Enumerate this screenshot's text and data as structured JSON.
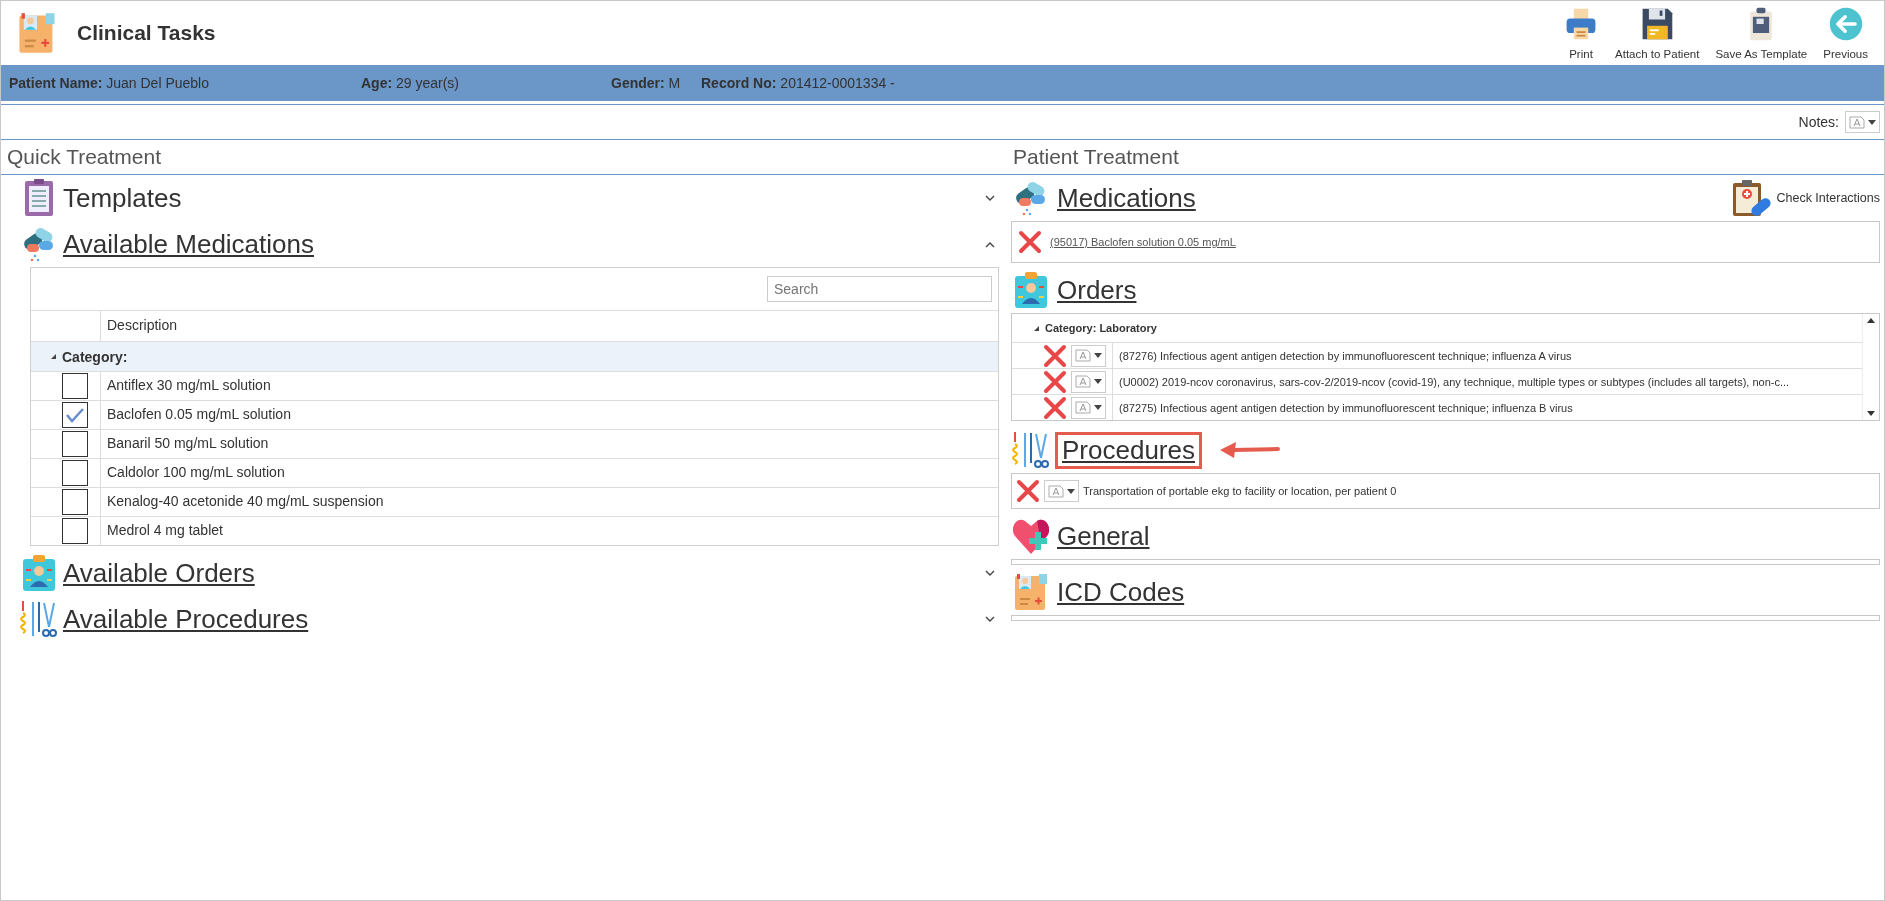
{
  "window": {
    "title": "Clinical Tasks"
  },
  "toolbar": [
    {
      "kind": "print",
      "label": "Print"
    },
    {
      "kind": "attach",
      "label": "Attach to Patient"
    },
    {
      "kind": "template",
      "label": "Save As Template"
    },
    {
      "kind": "previous",
      "label": "Previous"
    }
  ],
  "patient_bar": [
    {
      "label": "Patient Name:",
      "value": "Juan Del Pueblo"
    },
    {
      "label": "Age:",
      "value": "29 year(s)"
    },
    {
      "label": "Gender:",
      "value": "M"
    },
    {
      "label": "Record No:",
      "value": "201412-0001334 -"
    }
  ],
  "notes": {
    "label": "Notes:"
  },
  "quick_treatment": {
    "title": "Quick Treatment",
    "sections": [
      {
        "kind": "templates",
        "title": "Templates",
        "underlined": false,
        "expanded": false
      },
      {
        "kind": "medications",
        "title": "Available Medications",
        "underlined": true,
        "expanded": true,
        "table": {
          "search": {
            "placeholder": "Search"
          },
          "columns": [
            "Description"
          ],
          "group": "Category:",
          "rows": [
            {
              "text": "Antiflex 30 mg/mL solution",
              "checked": false
            },
            {
              "text": "Baclofen 0.05 mg/mL solution",
              "checked": true
            },
            {
              "text": "Banaril 50 mg/mL solution",
              "checked": false
            },
            {
              "text": "Caldolor 100 mg/mL solution",
              "checked": false
            },
            {
              "text": "Kenalog-40 acetonide 40 mg/mL suspension",
              "checked": false
            },
            {
              "text": "Medrol 4 mg tablet",
              "checked": false
            }
          ]
        }
      },
      {
        "kind": "orders",
        "title": "Available Orders",
        "underlined": true,
        "expanded": false
      },
      {
        "kind": "procedures",
        "title": "Available Procedures",
        "underlined": true,
        "expanded": false
      }
    ]
  },
  "patient_treatment": {
    "title": "Patient Treatment",
    "sections": [
      {
        "kind": "medications",
        "title": "Medications",
        "action": "Check Interactions",
        "items": [
          {
            "text": "(95017) Baclofen solution 0.05 mg/mL"
          }
        ]
      },
      {
        "kind": "orders",
        "title": "Orders",
        "group": "Category: Laboratory",
        "items": [
          {
            "text": "(87276) Infectious agent antigen detection by immunofluorescent technique; influenza A virus"
          },
          {
            "text": "(U0002) 2019-ncov coronavirus, sars-cov-2/2019-ncov (covid-19), any technique, multiple types or subtypes (includes all targets), non-c..."
          },
          {
            "text": "(87275) Infectious agent antigen detection by immunofluorescent technique; influenza B virus"
          }
        ]
      },
      {
        "kind": "procedures",
        "title": "Procedures",
        "highlighted": true,
        "items": [
          {
            "text": "Transportation of portable ekg to facility or location, per patient 0"
          }
        ]
      },
      {
        "kind": "general",
        "title": "General"
      },
      {
        "kind": "icd",
        "title": "ICD Codes"
      }
    ]
  }
}
